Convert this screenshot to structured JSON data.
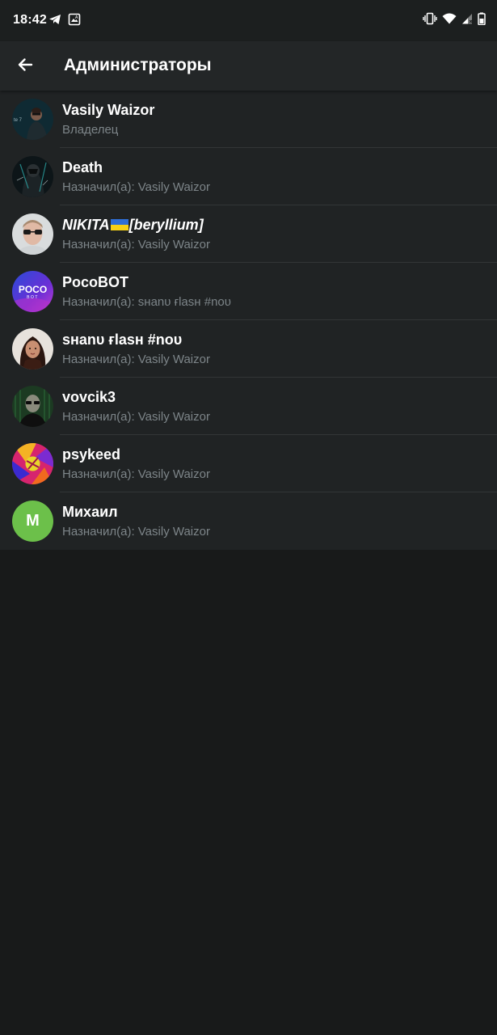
{
  "status_bar": {
    "time": "18:42"
  },
  "app_bar": {
    "title": "Администраторы"
  },
  "admins": [
    {
      "name": "Vasily Waizor",
      "subtitle": "Владелец"
    },
    {
      "name": "Death",
      "subtitle": "Назначил(а): Vasily Waizor"
    },
    {
      "name_prefix": "NIKITA",
      "name_suffix": "[beryllium]",
      "subtitle": "Назначил(а): Vasily Waizor"
    },
    {
      "name": "PocoBOT",
      "subtitle": "Назначил(а): sнanυ ғlasн #noυ",
      "avatar_text": "POCO",
      "avatar_subtext": "BOT"
    },
    {
      "name": "sнanυ ғlasн #noυ",
      "subtitle": "Назначил(а): Vasily Waizor"
    },
    {
      "name": "vovcik3",
      "subtitle": "Назначил(а): Vasily Waizor"
    },
    {
      "name": "psykeed",
      "subtitle": "Назначил(а): Vasily Waizor"
    },
    {
      "name": "Михаил",
      "subtitle": "Назначил(а): Vasily Waizor",
      "avatar_letter": "M",
      "avatar_color": "#6cc04a"
    }
  ],
  "colors": {
    "background": "#181a1a",
    "list_background": "#202324",
    "app_bar": "#232627",
    "subtitle_text": "#7d8589",
    "divider": "#323637"
  },
  "icons": {
    "status_left": [
      "telegram-icon",
      "image-notification-icon"
    ],
    "status_right": [
      "vibrate-icon",
      "wifi-icon",
      "signal-icon",
      "battery-icon"
    ],
    "app_bar": "back-arrow-icon"
  }
}
